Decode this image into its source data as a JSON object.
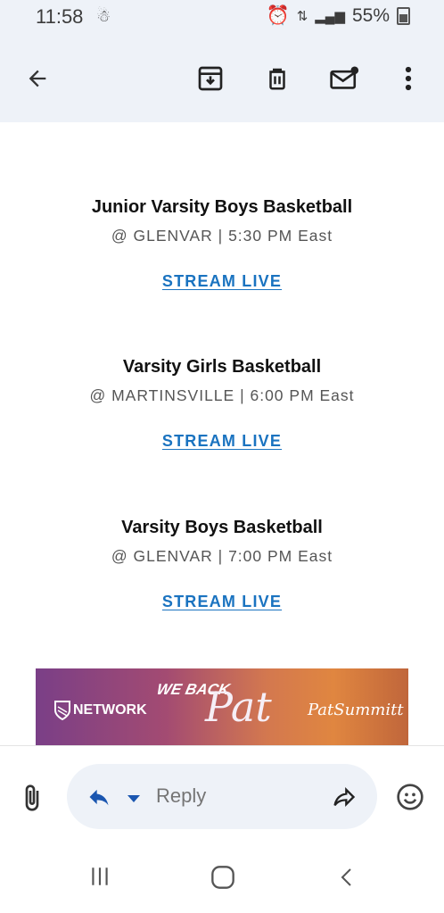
{
  "status_bar": {
    "time": "11:58",
    "battery": "55%"
  },
  "toolbar": {
    "icons": [
      "back-arrow-icon",
      "archive-icon",
      "delete-icon",
      "mark-unread-icon",
      "more-options-icon"
    ]
  },
  "events": [
    {
      "title": "Junior Varsity Boys Basketball",
      "subtitle": "@ GLENVAR | 5:30 PM East",
      "link": "STREAM LIVE"
    },
    {
      "title": "Varsity Girls Basketball",
      "subtitle": "@ MARTINSVILLE | 6:00 PM East",
      "link": "STREAM LIVE"
    },
    {
      "title": "Varsity Boys Basketball",
      "subtitle": "@ GLENVAR | 7:00 PM East",
      "link": "STREAM LIVE"
    }
  ],
  "banner": {
    "network": "NETWORK",
    "we_back": "WE BACK",
    "pat": "Pat",
    "signature": "PatSummitt"
  },
  "reply_bar": {
    "placeholder": "Reply"
  },
  "colors": {
    "header_bg": "#eef2f8",
    "link": "#1a73c0"
  }
}
